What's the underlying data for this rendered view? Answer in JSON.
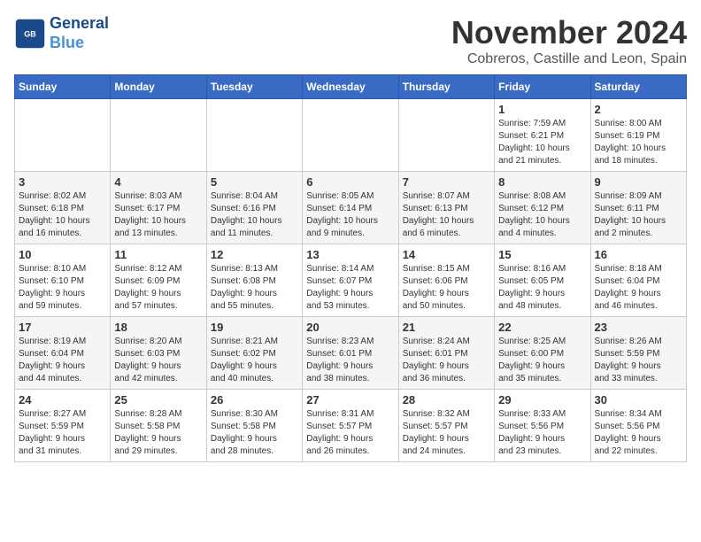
{
  "header": {
    "logo_general": "General",
    "logo_blue": "Blue",
    "month": "November 2024",
    "location": "Cobreros, Castille and Leon, Spain"
  },
  "days_of_week": [
    "Sunday",
    "Monday",
    "Tuesday",
    "Wednesday",
    "Thursday",
    "Friday",
    "Saturday"
  ],
  "weeks": [
    [
      {
        "day": "",
        "info": ""
      },
      {
        "day": "",
        "info": ""
      },
      {
        "day": "",
        "info": ""
      },
      {
        "day": "",
        "info": ""
      },
      {
        "day": "",
        "info": ""
      },
      {
        "day": "1",
        "info": "Sunrise: 7:59 AM\nSunset: 6:21 PM\nDaylight: 10 hours\nand 21 minutes."
      },
      {
        "day": "2",
        "info": "Sunrise: 8:00 AM\nSunset: 6:19 PM\nDaylight: 10 hours\nand 18 minutes."
      }
    ],
    [
      {
        "day": "3",
        "info": "Sunrise: 8:02 AM\nSunset: 6:18 PM\nDaylight: 10 hours\nand 16 minutes."
      },
      {
        "day": "4",
        "info": "Sunrise: 8:03 AM\nSunset: 6:17 PM\nDaylight: 10 hours\nand 13 minutes."
      },
      {
        "day": "5",
        "info": "Sunrise: 8:04 AM\nSunset: 6:16 PM\nDaylight: 10 hours\nand 11 minutes."
      },
      {
        "day": "6",
        "info": "Sunrise: 8:05 AM\nSunset: 6:14 PM\nDaylight: 10 hours\nand 9 minutes."
      },
      {
        "day": "7",
        "info": "Sunrise: 8:07 AM\nSunset: 6:13 PM\nDaylight: 10 hours\nand 6 minutes."
      },
      {
        "day": "8",
        "info": "Sunrise: 8:08 AM\nSunset: 6:12 PM\nDaylight: 10 hours\nand 4 minutes."
      },
      {
        "day": "9",
        "info": "Sunrise: 8:09 AM\nSunset: 6:11 PM\nDaylight: 10 hours\nand 2 minutes."
      }
    ],
    [
      {
        "day": "10",
        "info": "Sunrise: 8:10 AM\nSunset: 6:10 PM\nDaylight: 9 hours\nand 59 minutes."
      },
      {
        "day": "11",
        "info": "Sunrise: 8:12 AM\nSunset: 6:09 PM\nDaylight: 9 hours\nand 57 minutes."
      },
      {
        "day": "12",
        "info": "Sunrise: 8:13 AM\nSunset: 6:08 PM\nDaylight: 9 hours\nand 55 minutes."
      },
      {
        "day": "13",
        "info": "Sunrise: 8:14 AM\nSunset: 6:07 PM\nDaylight: 9 hours\nand 53 minutes."
      },
      {
        "day": "14",
        "info": "Sunrise: 8:15 AM\nSunset: 6:06 PM\nDaylight: 9 hours\nand 50 minutes."
      },
      {
        "day": "15",
        "info": "Sunrise: 8:16 AM\nSunset: 6:05 PM\nDaylight: 9 hours\nand 48 minutes."
      },
      {
        "day": "16",
        "info": "Sunrise: 8:18 AM\nSunset: 6:04 PM\nDaylight: 9 hours\nand 46 minutes."
      }
    ],
    [
      {
        "day": "17",
        "info": "Sunrise: 8:19 AM\nSunset: 6:04 PM\nDaylight: 9 hours\nand 44 minutes."
      },
      {
        "day": "18",
        "info": "Sunrise: 8:20 AM\nSunset: 6:03 PM\nDaylight: 9 hours\nand 42 minutes."
      },
      {
        "day": "19",
        "info": "Sunrise: 8:21 AM\nSunset: 6:02 PM\nDaylight: 9 hours\nand 40 minutes."
      },
      {
        "day": "20",
        "info": "Sunrise: 8:23 AM\nSunset: 6:01 PM\nDaylight: 9 hours\nand 38 minutes."
      },
      {
        "day": "21",
        "info": "Sunrise: 8:24 AM\nSunset: 6:01 PM\nDaylight: 9 hours\nand 36 minutes."
      },
      {
        "day": "22",
        "info": "Sunrise: 8:25 AM\nSunset: 6:00 PM\nDaylight: 9 hours\nand 35 minutes."
      },
      {
        "day": "23",
        "info": "Sunrise: 8:26 AM\nSunset: 5:59 PM\nDaylight: 9 hours\nand 33 minutes."
      }
    ],
    [
      {
        "day": "24",
        "info": "Sunrise: 8:27 AM\nSunset: 5:59 PM\nDaylight: 9 hours\nand 31 minutes."
      },
      {
        "day": "25",
        "info": "Sunrise: 8:28 AM\nSunset: 5:58 PM\nDaylight: 9 hours\nand 29 minutes."
      },
      {
        "day": "26",
        "info": "Sunrise: 8:30 AM\nSunset: 5:58 PM\nDaylight: 9 hours\nand 28 minutes."
      },
      {
        "day": "27",
        "info": "Sunrise: 8:31 AM\nSunset: 5:57 PM\nDaylight: 9 hours\nand 26 minutes."
      },
      {
        "day": "28",
        "info": "Sunrise: 8:32 AM\nSunset: 5:57 PM\nDaylight: 9 hours\nand 24 minutes."
      },
      {
        "day": "29",
        "info": "Sunrise: 8:33 AM\nSunset: 5:56 PM\nDaylight: 9 hours\nand 23 minutes."
      },
      {
        "day": "30",
        "info": "Sunrise: 8:34 AM\nSunset: 5:56 PM\nDaylight: 9 hours\nand 22 minutes."
      }
    ]
  ]
}
